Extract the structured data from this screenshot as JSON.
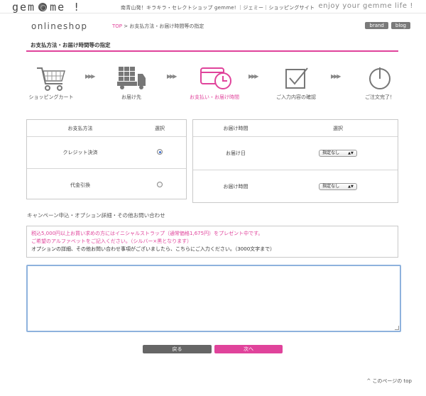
{
  "header": {
    "logo": "gem me!",
    "logo_parts": [
      "gem",
      "me !"
    ],
    "tagline": "南青山発！キラキラ・セレクトショップ gemme! ｜ジェミー｜ショッピングサイト",
    "enjoy": "enjoy your gemme life !"
  },
  "subheader": {
    "shop": "onlineshop",
    "breadcrumb_top": "TOP",
    "breadcrumb_sep": ">",
    "breadcrumb_current": "お支払方法・お届け時間等の指定",
    "brand": "brand",
    "blog": "blog"
  },
  "page_title": "お支払方法・お届け時間等の指定",
  "steps": [
    {
      "label": "ショッピングカート",
      "icon": "cart-icon"
    },
    {
      "label": "お届け先",
      "icon": "truck-icon"
    },
    {
      "label": "お支払い・お届け時間",
      "icon": "card-clock-icon",
      "active": true
    },
    {
      "label": "ご入力内容の確認",
      "icon": "checkbox-icon"
    },
    {
      "label": "ご注文完了！",
      "icon": "power-icon"
    }
  ],
  "step_arrow": "▶▶▶",
  "payment": {
    "header_method": "お支払方法",
    "header_select": "選択",
    "rows": [
      {
        "label": "クレジット決済",
        "selected": true
      },
      {
        "label": "代金引換",
        "selected": false
      }
    ]
  },
  "delivery": {
    "header_time": "お届け時間",
    "header_select": "選択",
    "rows": [
      {
        "label": "お届け日",
        "value": "指定なし"
      },
      {
        "label": "お届け時間",
        "value": "指定なし"
      }
    ]
  },
  "campaign": {
    "title": "キャンペーン申込・オプション詳細・その他お問い合わせ",
    "line1": "税込5,000円以上お買い求めの方にはイニシャルストラップ（通常価格1,675円）をプレゼント中です。",
    "line2": "ご希望のアルファベットをご記入ください。（シルバー×黒となります）",
    "line3": "オプションの詳細、その他お問い合わせ事項がございましたら、こちらにご入力ください。（3000文字まで）",
    "textarea_value": ""
  },
  "buttons": {
    "back": "戻る",
    "next": "次へ"
  },
  "footer": {
    "to_top": "このページの top"
  },
  "colors": {
    "accent": "#e0439b",
    "button_back": "#666666",
    "textarea_border": "#8eb2dd"
  }
}
